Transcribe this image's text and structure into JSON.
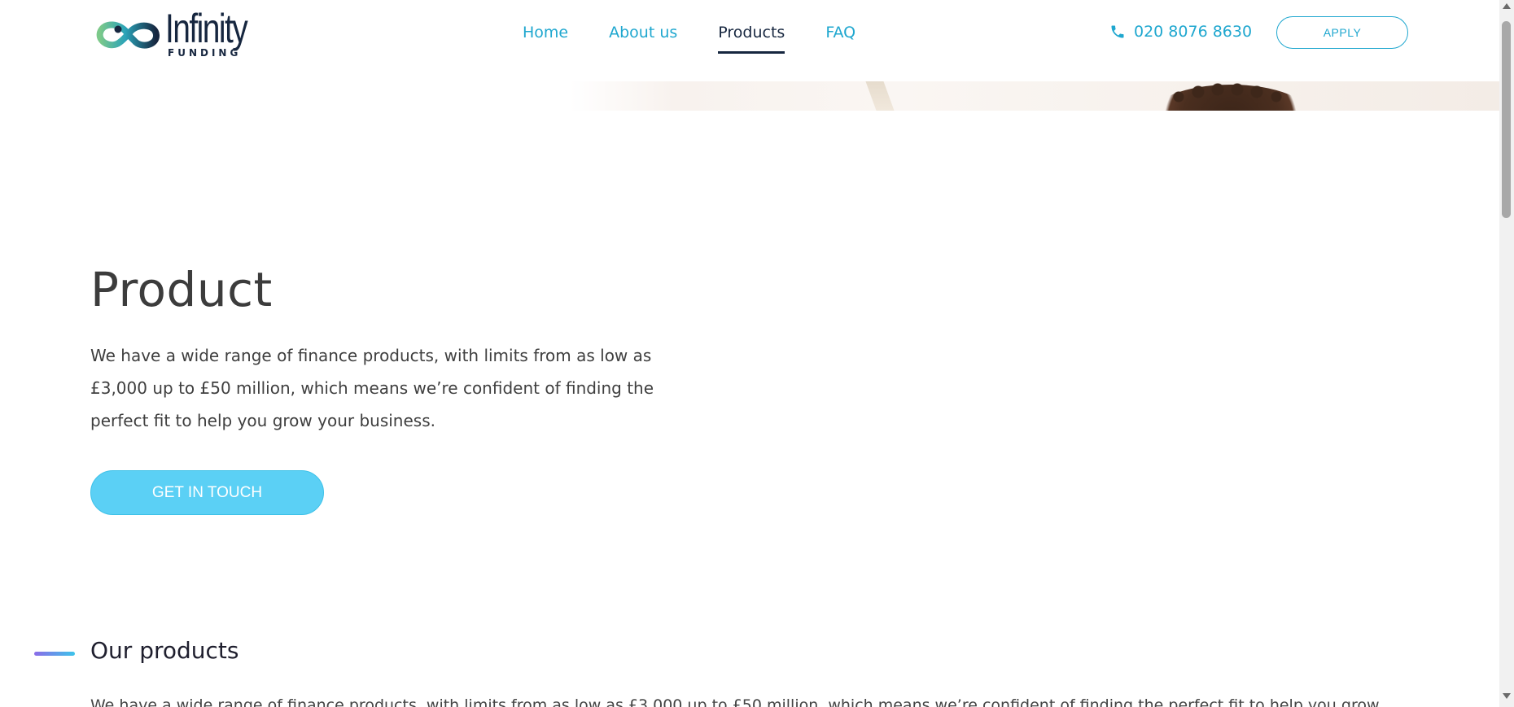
{
  "header": {
    "logo": {
      "word": "Infinity",
      "subword": "FUNDING",
      "icon": "infinity-loop-icon",
      "colors": {
        "green": "#6fc48a",
        "teal": "#1fa7cf",
        "navy": "#16263f"
      }
    },
    "nav": [
      {
        "label": "Home",
        "active": false
      },
      {
        "label": "About us",
        "active": false
      },
      {
        "label": "Products",
        "active": true
      },
      {
        "label": "FAQ",
        "active": false
      }
    ],
    "phone": {
      "icon": "phone-icon",
      "number": "020 8076 8630"
    },
    "apply_label": "APPLY"
  },
  "hero": {
    "title": "Product",
    "description": "We have a wide range of finance products, with limits from as low as £3,000 up to £50 million, which means we’re confident of finding the perfect fit to help you grow your business.",
    "cta_label": "GET IN TOUCH"
  },
  "products_section": {
    "title": "Our products",
    "description": "We have a wide range of finance products, with limits from as low as £3,000 up to £50 million, which means we’re confident of finding the perfect fit to help you grow"
  },
  "colors": {
    "accent": "#1fa7cf",
    "active_nav": "#16263f",
    "cta_fill": "#5bd0f5"
  }
}
